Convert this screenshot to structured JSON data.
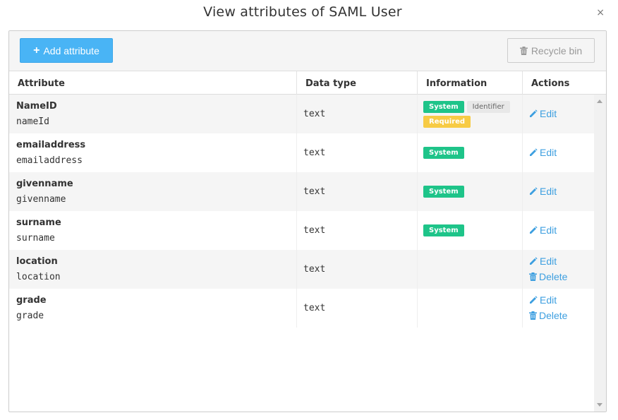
{
  "dialog": {
    "title": "View attributes of SAML User",
    "close_symbol": "×"
  },
  "toolbar": {
    "add_label": "Add attribute",
    "recycle_label": "Recycle bin"
  },
  "table": {
    "columns": [
      "Attribute",
      "Data type",
      "Information",
      "Actions"
    ],
    "rows": [
      {
        "name": "NameID",
        "key": "nameId",
        "type": "text",
        "badges": [
          "System",
          "Identifier",
          "Required"
        ],
        "actions": [
          "Edit"
        ]
      },
      {
        "name": "emailaddress",
        "key": "emailaddress",
        "type": "text",
        "badges": [
          "System"
        ],
        "actions": [
          "Edit"
        ]
      },
      {
        "name": "givenname",
        "key": "givenname",
        "type": "text",
        "badges": [
          "System"
        ],
        "actions": [
          "Edit"
        ]
      },
      {
        "name": "surname",
        "key": "surname",
        "type": "text",
        "badges": [
          "System"
        ],
        "actions": [
          "Edit"
        ]
      },
      {
        "name": "location",
        "key": "location",
        "type": "text",
        "badges": [],
        "actions": [
          "Edit",
          "Delete"
        ]
      },
      {
        "name": "grade",
        "key": "grade",
        "type": "text",
        "badges": [],
        "actions": [
          "Edit",
          "Delete"
        ]
      }
    ]
  },
  "colors": {
    "primary": "#49b4f5",
    "link": "#3d9fe0",
    "system_badge": "#1ec489",
    "identifier_badge": "#e8e8e8",
    "required_badge": "#f7cb45"
  },
  "icons": {
    "add": "plus-icon",
    "recycle": "trash-icon",
    "edit": "pencil-icon",
    "delete": "trash-icon",
    "close": "close-icon"
  }
}
